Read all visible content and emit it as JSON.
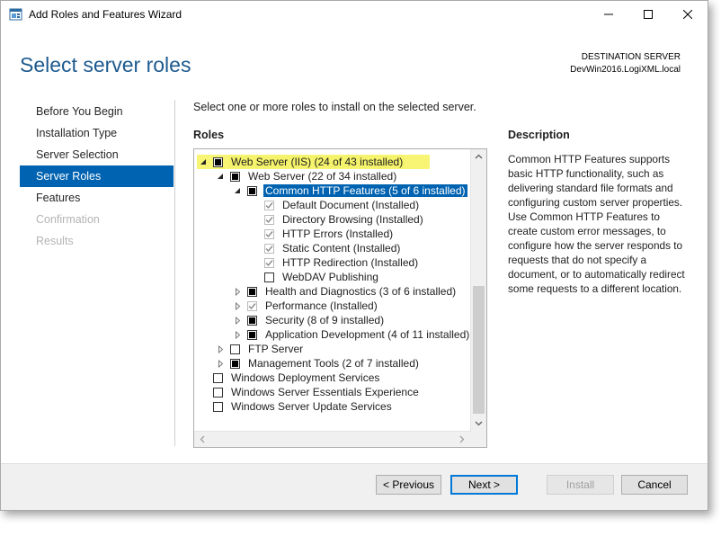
{
  "window": {
    "title": "Add Roles and Features Wizard"
  },
  "header": {
    "page_title": "Select server roles",
    "destination_label": "DESTINATION SERVER",
    "destination_server": "DevWin2016.LogiXML.local"
  },
  "steps": [
    {
      "label": "Before You Begin",
      "state": "normal"
    },
    {
      "label": "Installation Type",
      "state": "normal"
    },
    {
      "label": "Server Selection",
      "state": "normal"
    },
    {
      "label": "Server Roles",
      "state": "active"
    },
    {
      "label": "Features",
      "state": "normal"
    },
    {
      "label": "Confirmation",
      "state": "disabled"
    },
    {
      "label": "Results",
      "state": "disabled"
    }
  ],
  "main": {
    "instruction": "Select one or more roles to install on the selected server.",
    "roles_heading": "Roles",
    "description_heading": "Description",
    "description_text": "Common HTTP Features supports basic HTTP functionality, such as delivering standard file formats and configuring custom server properties. Use Common HTTP Features to create custom error messages, to configure how the server responds to requests that do not specify a document, or to automatically redirect some requests to a different location."
  },
  "roles": [
    {
      "label": "Web Server (IIS) (24 of 43 installed)",
      "level": 0,
      "expander": "expanded",
      "check": "partial",
      "highlight": "yellow"
    },
    {
      "label": "Web Server (22 of 34 installed)",
      "level": 1,
      "expander": "expanded",
      "check": "partial"
    },
    {
      "label": "Common HTTP Features (5 of 6 installed)",
      "level": 2,
      "expander": "expanded",
      "check": "partial",
      "highlight": "selected"
    },
    {
      "label": "Default Document (Installed)",
      "level": 3,
      "expander": "none",
      "check": "checked-disabled"
    },
    {
      "label": "Directory Browsing (Installed)",
      "level": 3,
      "expander": "none",
      "check": "checked-disabled"
    },
    {
      "label": "HTTP Errors (Installed)",
      "level": 3,
      "expander": "none",
      "check": "checked-disabled"
    },
    {
      "label": "Static Content (Installed)",
      "level": 3,
      "expander": "none",
      "check": "checked-disabled"
    },
    {
      "label": "HTTP Redirection (Installed)",
      "level": 3,
      "expander": "none",
      "check": "checked-disabled"
    },
    {
      "label": "WebDAV Publishing",
      "level": 3,
      "expander": "none",
      "check": "unchecked"
    },
    {
      "label": "Health and Diagnostics (3 of 6 installed)",
      "level": 2,
      "expander": "collapsed",
      "check": "partial"
    },
    {
      "label": "Performance (Installed)",
      "level": 2,
      "expander": "collapsed",
      "check": "checked-disabled"
    },
    {
      "label": "Security (8 of 9 installed)",
      "level": 2,
      "expander": "collapsed",
      "check": "partial"
    },
    {
      "label": "Application Development (4 of 11 installed)",
      "level": 2,
      "expander": "collapsed",
      "check": "partial"
    },
    {
      "label": "FTP Server",
      "level": 1,
      "expander": "collapsed",
      "check": "unchecked"
    },
    {
      "label": "Management Tools (2 of 7 installed)",
      "level": 1,
      "expander": "collapsed",
      "check": "partial"
    },
    {
      "label": "Windows Deployment Services",
      "level": 0,
      "expander": "none",
      "check": "unchecked"
    },
    {
      "label": "Windows Server Essentials Experience",
      "level": 0,
      "expander": "none",
      "check": "unchecked"
    },
    {
      "label": "Windows Server Update Services",
      "level": 0,
      "expander": "none",
      "check": "unchecked"
    }
  ],
  "footer": {
    "previous_label": "< Previous",
    "next_label": "Next >",
    "install_label": "Install",
    "cancel_label": "Cancel"
  },
  "colors": {
    "accent": "#0063b1",
    "title": "#1e5a8f",
    "highlight": "#f5f36b"
  }
}
